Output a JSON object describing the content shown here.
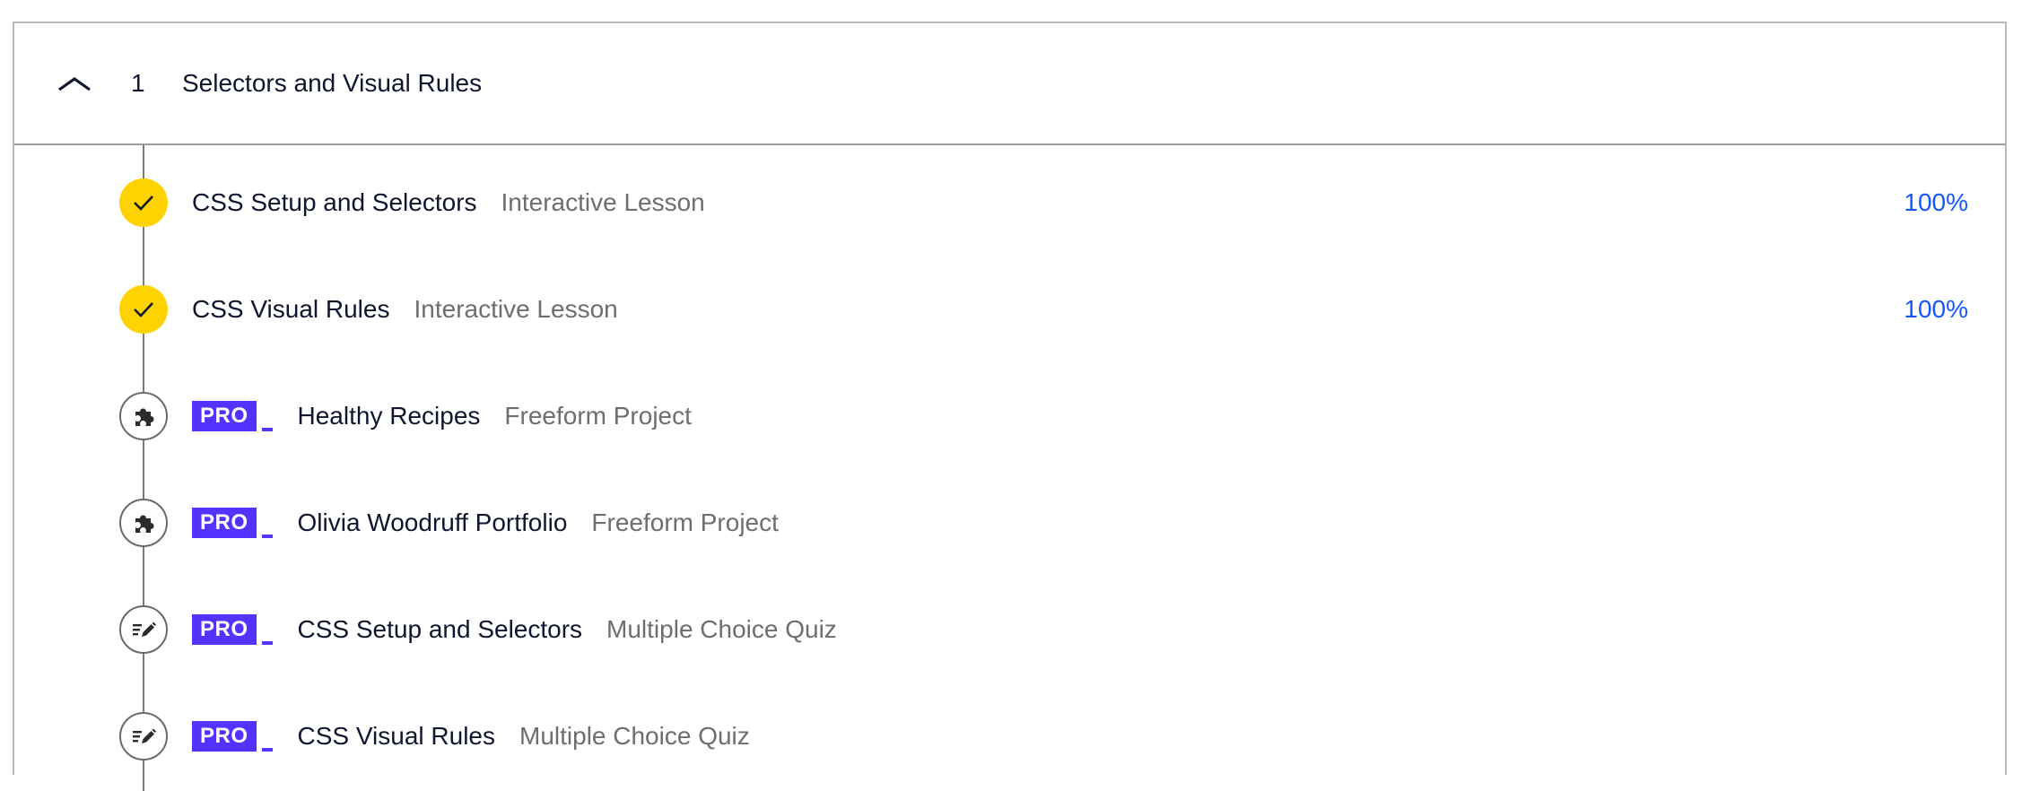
{
  "section": {
    "number": "1",
    "title": "Selectors and Visual Rules",
    "chevron_icon": "chevron-up-icon",
    "expanded": true
  },
  "colors": {
    "completed_marker": "#ffd300",
    "pro_badge": "#5533ff",
    "progress_text": "#1557ff",
    "type_text": "#6e6e6e"
  },
  "items": [
    {
      "title": "CSS Setup and Selectors",
      "type": "Interactive Lesson",
      "status": "completed",
      "icon": "checkmark-icon",
      "pro": false,
      "progress": "100%"
    },
    {
      "title": "CSS Visual Rules",
      "type": "Interactive Lesson",
      "status": "completed",
      "icon": "checkmark-icon",
      "pro": false,
      "progress": "100%"
    },
    {
      "title": "Healthy Recipes",
      "type": "Freeform Project",
      "status": "locked",
      "icon": "puzzle-piece-icon",
      "pro": true,
      "pro_label": "PRO"
    },
    {
      "title": "Olivia Woodruff Portfolio",
      "type": "Freeform Project",
      "status": "locked",
      "icon": "puzzle-piece-icon",
      "pro": true,
      "pro_label": "PRO"
    },
    {
      "title": "CSS Setup and Selectors",
      "type": "Multiple Choice Quiz",
      "status": "locked",
      "icon": "quiz-pencil-icon",
      "pro": true,
      "pro_label": "PRO"
    },
    {
      "title": "CSS Visual Rules",
      "type": "Multiple Choice Quiz",
      "status": "locked",
      "icon": "quiz-pencil-icon",
      "pro": true,
      "pro_label": "PRO"
    }
  ]
}
